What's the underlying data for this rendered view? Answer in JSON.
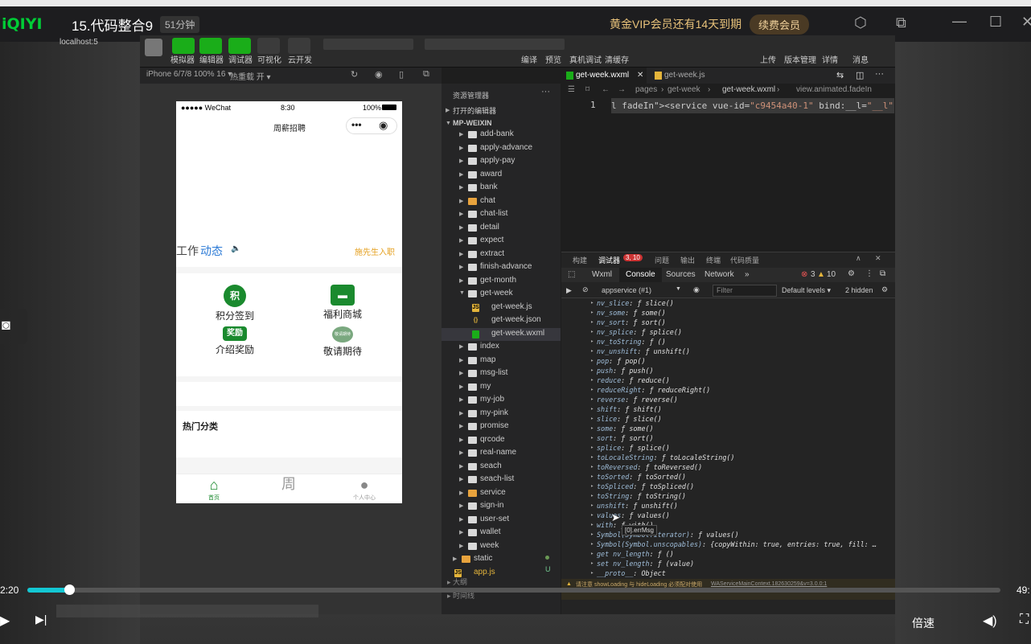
{
  "player": {
    "logo": "iQIYI",
    "title": "15.代码整合9",
    "duration": "51分钟",
    "vip_text": "黄金VIP会员还有14天到期",
    "renew_label": "续费会员",
    "time_current": "2:20",
    "time_total": "49:",
    "speed_label": "倍速",
    "progress_fraction": 0.043
  },
  "ide": {
    "toolbar": {
      "url": "localhost:5",
      "buttons": [
        "模拟器",
        "编辑器",
        "调试器",
        "可视化",
        "云开发"
      ],
      "right_buttons": [
        "编译",
        "预览",
        "真机调试",
        "清缓存"
      ],
      "far_right": [
        "上传",
        "版本管理",
        "详情",
        "消息"
      ]
    },
    "sim_header": {
      "device": "iPhone 6/7/8 100% 16 ▾",
      "reload": "热重载 开 ▾"
    },
    "explorer": {
      "title": "资源管理器",
      "open_editors": "打开的编辑器",
      "project": "MP-WEIXIN",
      "items": [
        {
          "name": "add-bank",
          "type": "folder",
          "level": 1
        },
        {
          "name": "apply-advance",
          "type": "folder",
          "level": 1
        },
        {
          "name": "apply-pay",
          "type": "folder",
          "level": 1
        },
        {
          "name": "award",
          "type": "folder",
          "level": 1
        },
        {
          "name": "bank",
          "type": "folder",
          "level": 1
        },
        {
          "name": "chat",
          "type": "folder",
          "level": 1
        },
        {
          "name": "chat-list",
          "type": "folder",
          "level": 1
        },
        {
          "name": "detail",
          "type": "folder",
          "level": 1
        },
        {
          "name": "expect",
          "type": "folder",
          "level": 1
        },
        {
          "name": "extract",
          "type": "folder",
          "level": 1
        },
        {
          "name": "finish-advance",
          "type": "folder",
          "level": 1
        },
        {
          "name": "get-month",
          "type": "folder",
          "level": 1
        },
        {
          "name": "get-week",
          "type": "folder-open",
          "level": 1
        },
        {
          "name": "get-week.js",
          "type": "js",
          "level": 2
        },
        {
          "name": "get-week.json",
          "type": "json",
          "level": 2
        },
        {
          "name": "get-week.wxml",
          "type": "wxml",
          "level": 2
        },
        {
          "name": "index",
          "type": "folder",
          "level": 1
        },
        {
          "name": "map",
          "type": "folder",
          "level": 1
        },
        {
          "name": "msg-list",
          "type": "folder",
          "level": 1
        },
        {
          "name": "my",
          "type": "folder",
          "level": 1
        },
        {
          "name": "my-job",
          "type": "folder",
          "level": 1
        },
        {
          "name": "my-pink",
          "type": "folder",
          "level": 1
        },
        {
          "name": "promise",
          "type": "folder",
          "level": 1
        },
        {
          "name": "qrcode",
          "type": "folder",
          "level": 1
        },
        {
          "name": "real-name",
          "type": "folder",
          "level": 1
        },
        {
          "name": "seach",
          "type": "folder",
          "level": 1
        },
        {
          "name": "seach-list",
          "type": "folder",
          "level": 1
        },
        {
          "name": "service",
          "type": "folder",
          "level": 1
        },
        {
          "name": "sign-in",
          "type": "folder",
          "level": 1
        },
        {
          "name": "user-set",
          "type": "folder",
          "level": 1
        },
        {
          "name": "wallet",
          "type": "folder",
          "level": 1
        },
        {
          "name": "week",
          "type": "folder",
          "level": 1
        },
        {
          "name": "static",
          "type": "folder",
          "level": 0
        },
        {
          "name": "app.js",
          "type": "js",
          "level": 0
        }
      ],
      "status_u": "U",
      "footer1": "大纲",
      "footer2": "时间线"
    },
    "editor": {
      "tabs": [
        "get-week.wxml",
        "get-week.js"
      ],
      "breadcrumb": [
        "pages",
        "get-week",
        "get-week.wxml",
        "view.animated.fadeIn"
      ],
      "line_number": "1",
      "code_prefix": "l fadeIn\"><service vue-id=",
      "code_string": "\"c9454a40-1\"",
      "code_suffix": " bind:__l=",
      "code_string2": "\"__l\""
    },
    "debugger": {
      "tabs": [
        "构建",
        "调试器",
        "问题",
        "输出",
        "终端",
        "代码质量"
      ],
      "badge": "3, 10",
      "devtools_tabs": [
        "Wxml",
        "Console",
        "Sources",
        "Network",
        "»"
      ],
      "errors": "3",
      "warnings": "10",
      "context": "appservice (#1)",
      "filter_placeholder": "Filter",
      "levels": "Default levels ▾",
      "hidden": "2 hidden",
      "console": [
        {
          "k": "nv_slice",
          "v": "ƒ slice()"
        },
        {
          "k": "nv_some",
          "v": "ƒ some()"
        },
        {
          "k": "nv_sort",
          "v": "ƒ sort()"
        },
        {
          "k": "nv_splice",
          "v": "ƒ splice()"
        },
        {
          "k": "nv_toString",
          "v": "ƒ ()"
        },
        {
          "k": "nv_unshift",
          "v": "ƒ unshift()"
        },
        {
          "k": "pop",
          "v": "ƒ pop()"
        },
        {
          "k": "push",
          "v": "ƒ push()"
        },
        {
          "k": "reduce",
          "v": "ƒ reduce()"
        },
        {
          "k": "reduceRight",
          "v": "ƒ reduceRight()"
        },
        {
          "k": "reverse",
          "v": "ƒ reverse()"
        },
        {
          "k": "shift",
          "v": "ƒ shift()"
        },
        {
          "k": "slice",
          "v": "ƒ slice()"
        },
        {
          "k": "some",
          "v": "ƒ some()"
        },
        {
          "k": "sort",
          "v": "ƒ sort()"
        },
        {
          "k": "splice",
          "v": "ƒ splice()"
        },
        {
          "k": "toLocaleString",
          "v": "ƒ toLocaleString()"
        },
        {
          "k": "toReversed",
          "v": "ƒ toReversed()"
        },
        {
          "k": "toSorted",
          "v": "ƒ toSorted()"
        },
        {
          "k": "toSpliced",
          "v": "ƒ toSpliced()"
        },
        {
          "k": "toString",
          "v": "ƒ toString()"
        },
        {
          "k": "unshift",
          "v": "ƒ unshift()"
        },
        {
          "k": "values",
          "v": "ƒ values()"
        },
        {
          "k": "with",
          "v": "ƒ with()"
        },
        {
          "k": "Symbol(Symbol.iterator)",
          "v": "ƒ values()"
        },
        {
          "k": "Symbol(Symbol.unscopables)",
          "v": "{copyWithin: true, entries: true, fill: …"
        },
        {
          "k": "get nv_length",
          "v": "ƒ ()"
        },
        {
          "k": "set nv_length",
          "v": "ƒ (value)"
        },
        {
          "k": "__proto__",
          "v": "Object"
        }
      ],
      "tooltip": "[0].errMsg",
      "warn_text": "请注意 showLoading 与 hideLoading 必须配对使用",
      "warn_link": "WAServiceMainContext.182630259&v=3.0.0:1"
    }
  },
  "phone": {
    "status_left": "●●●●● WeChat",
    "status_time": "8:30",
    "status_right": "100%",
    "nav_title": "周薪招聘",
    "news_prefix": "工作",
    "news_highlight": "动态",
    "news_item": "施先生入职",
    "grid": [
      {
        "icon": "积",
        "label": "积分签到"
      },
      {
        "icon": "商",
        "label": "福利商城"
      },
      {
        "icon": "奖励",
        "label": "介绍奖励"
      },
      {
        "icon": "敬请期待",
        "label": "敬请期待"
      }
    ],
    "hot_title": "热门分类",
    "tabs": [
      "首页",
      "周",
      "个人中心"
    ]
  }
}
